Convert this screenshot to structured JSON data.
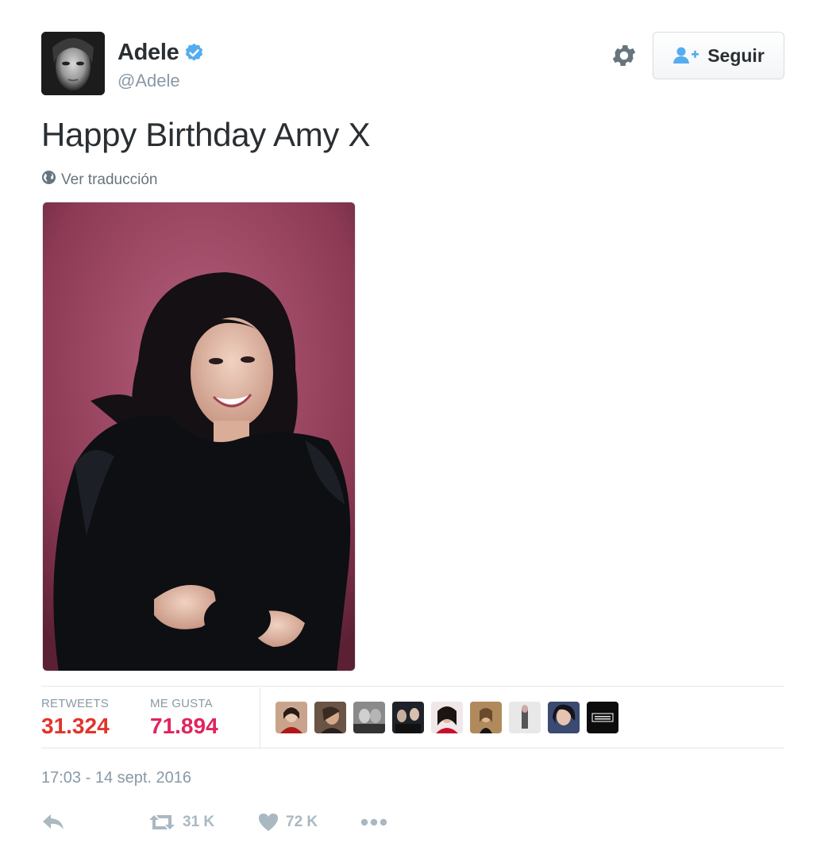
{
  "user": {
    "name": "Adele",
    "handle": "@Adele",
    "verified_icon": "verified-badge-icon"
  },
  "header": {
    "follow_label": "Seguir"
  },
  "tweet": {
    "text": "Happy Birthday Amy X",
    "translate_label": "Ver traducción",
    "timestamp": "17:03 - 14 sept. 2016"
  },
  "stats": {
    "retweets_label": "RETWEETS",
    "retweets_value": "31.324",
    "likes_label": "ME GUSTA",
    "likes_value": "71.894"
  },
  "actions": {
    "retweet_count": "31 K",
    "like_count": "72 K"
  },
  "colors": {
    "accent_blue": "#55acee",
    "count_red": "#e0245e",
    "muted": "#8899a6"
  }
}
